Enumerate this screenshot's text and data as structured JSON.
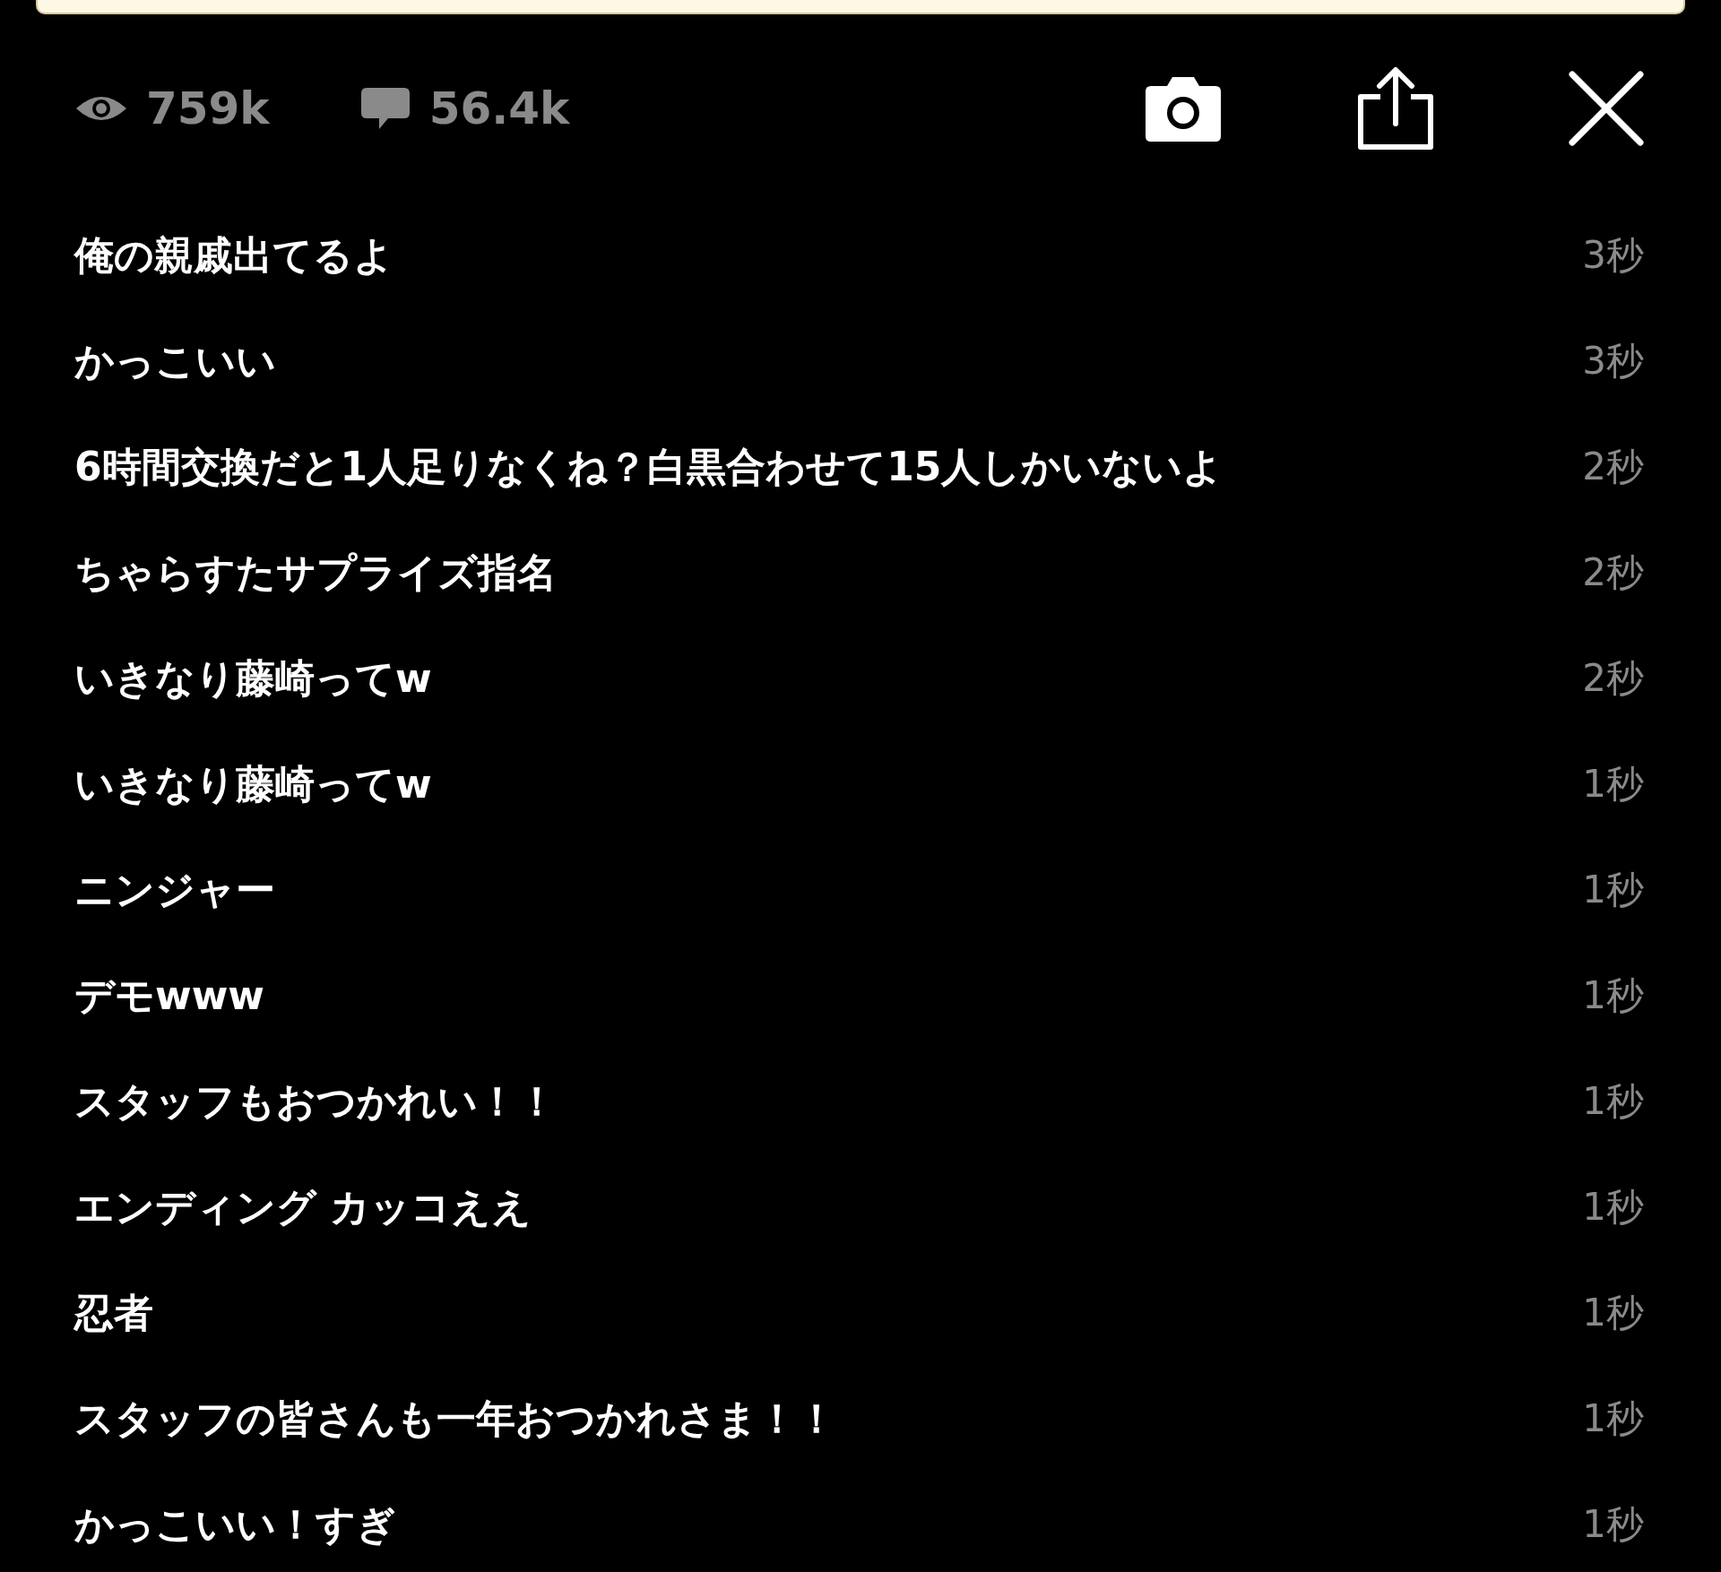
{
  "stats": {
    "views": "759k",
    "comments": "56.4k"
  },
  "comments": [
    {
      "text": "俺の親戚出てるよ",
      "time": "3秒"
    },
    {
      "text": "かっこいい",
      "time": "3秒"
    },
    {
      "text": "6時間交換だと1人足りなくね？白黒合わせて15人しかいないよ",
      "time": "2秒"
    },
    {
      "text": "ちゃらすたサプライズ指名",
      "time": "2秒"
    },
    {
      "text": "いきなり藤崎ってw",
      "time": "2秒"
    },
    {
      "text": "いきなり藤崎ってw",
      "time": "1秒"
    },
    {
      "text": "ニンジャー",
      "time": "1秒"
    },
    {
      "text": "デモwww",
      "time": "1秒"
    },
    {
      "text": "スタッフもおつかれい！！",
      "time": "1秒"
    },
    {
      "text": "エンディング カッコええ",
      "time": "1秒"
    },
    {
      "text": "忍者",
      "time": "1秒"
    },
    {
      "text": "スタッフの皆さんも一年おつかれさま！！",
      "time": "1秒"
    },
    {
      "text": "かっこいい！すぎ",
      "time": "1秒"
    }
  ]
}
